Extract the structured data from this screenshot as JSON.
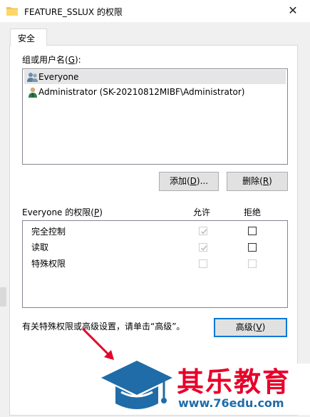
{
  "window": {
    "title": "FEATURE_SSLUX 的权限",
    "close_glyph": "✕"
  },
  "tabs": [
    {
      "label": "安全"
    }
  ],
  "groups": {
    "label_prefix": "组或用户名(",
    "label_mnemonic": "G",
    "label_suffix": "):",
    "items": [
      {
        "name": "Everyone",
        "icon": "users-icon",
        "selected": true
      },
      {
        "name": "Administrator (SK-20210812MIBF\\Administrator)",
        "icon": "user-icon",
        "selected": false
      }
    ]
  },
  "buttons": {
    "add_prefix": "添加(",
    "add_mnemonic": "D",
    "add_suffix": ")...",
    "remove_prefix": "删除(",
    "remove_mnemonic": "R",
    "remove_suffix": ")",
    "advanced_prefix": "高级(",
    "advanced_mnemonic": "V",
    "advanced_suffix": ")"
  },
  "permissions": {
    "label_prefix": "Everyone 的权限(",
    "label_mnemonic": "P",
    "label_suffix": ")",
    "col_allow": "允许",
    "col_deny": "拒绝",
    "rows": [
      {
        "name": "完全控制",
        "allow": true,
        "allow_enabled": false,
        "deny": false,
        "deny_enabled": true
      },
      {
        "name": "读取",
        "allow": true,
        "allow_enabled": false,
        "deny": false,
        "deny_enabled": true
      },
      {
        "name": "特殊权限",
        "allow": false,
        "allow_enabled": false,
        "deny": false,
        "deny_enabled": false
      }
    ]
  },
  "advanced_hint": "有关特殊权限或高级设置，请单击“高级”。",
  "watermark": {
    "brand": "其乐教育",
    "url": "www.76edu.com",
    "brand_color": "#e8002a",
    "url_color": "#1f6ca8",
    "cap_color": "#1f6ca8"
  },
  "colors": {
    "accent": "#0078d7",
    "arrow": "#e8002a"
  }
}
